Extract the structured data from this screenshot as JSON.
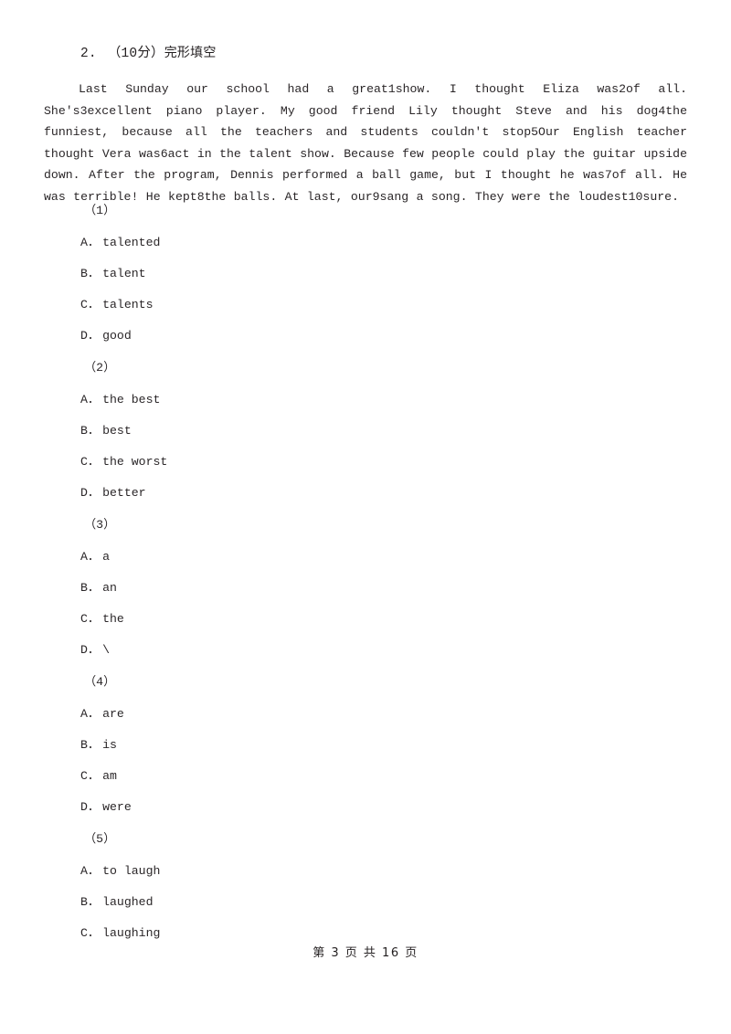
{
  "document": {
    "page_label": "第 3 页 共 16 页"
  },
  "question": {
    "number": "2.",
    "score": "（10分）",
    "title": "完形填空",
    "passage": "Last Sunday our school had a great1show. I thought Eliza was2of all. She's3excellent piano player. My good friend Lily thought Steve and his dog4the funniest, because all the teachers and students couldn't stop5Our English teacher thought Vera was6act in the talent show. Because few people could play the guitar upside down. After the program, Dennis performed a ball game, but I thought he was7of all. He was terrible! He kept8the balls. At last, our9sang a song. They were the loudest10sure."
  },
  "subquestions": [
    {
      "label": "（1）",
      "options": [
        {
          "key": "A．",
          "text": "talented"
        },
        {
          "key": "B．",
          "text": "talent"
        },
        {
          "key": "C．",
          "text": "talents"
        },
        {
          "key": "D．",
          "text": "good"
        }
      ]
    },
    {
      "label": "（2）",
      "options": [
        {
          "key": "A．",
          "text": "the best"
        },
        {
          "key": "B．",
          "text": "best"
        },
        {
          "key": "C．",
          "text": "the worst"
        },
        {
          "key": "D．",
          "text": "better"
        }
      ]
    },
    {
      "label": "（3）",
      "options": [
        {
          "key": "A．",
          "text": "a"
        },
        {
          "key": "B．",
          "text": "an"
        },
        {
          "key": "C．",
          "text": "the"
        },
        {
          "key": "D．",
          "text": "\\"
        }
      ]
    },
    {
      "label": "（4）",
      "options": [
        {
          "key": "A．",
          "text": "are"
        },
        {
          "key": "B．",
          "text": "is"
        },
        {
          "key": "C．",
          "text": "am"
        },
        {
          "key": "D．",
          "text": "were"
        }
      ]
    },
    {
      "label": "（5）",
      "options": [
        {
          "key": "A．",
          "text": "to laugh"
        },
        {
          "key": "B．",
          "text": "laughed"
        },
        {
          "key": "C．",
          "text": "laughing"
        }
      ]
    }
  ]
}
